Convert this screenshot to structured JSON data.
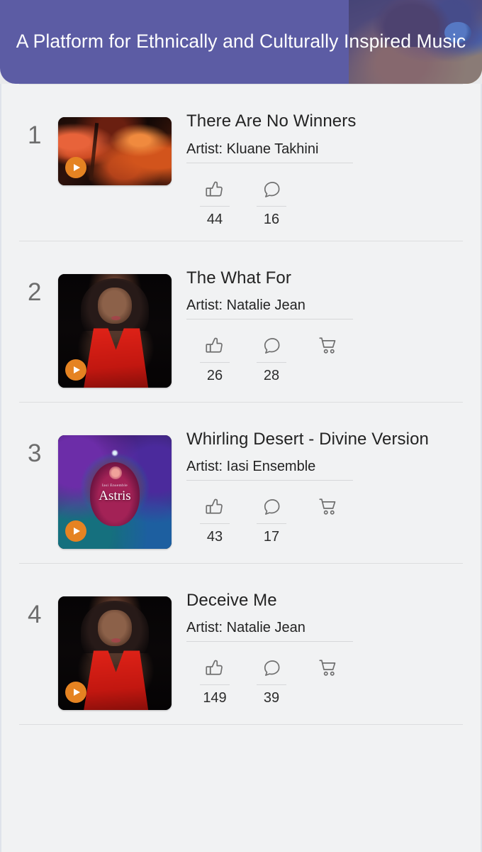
{
  "header": {
    "title": "A Platform for Ethnically and Culturally Inspired Music",
    "background_color": "#5c5ca4",
    "photo_alt": "woman-with-headphones-photo"
  },
  "accent_colors": {
    "play_button": "#e58322",
    "header_purple": "#5c5ca4",
    "page_background": "#f1f2f3",
    "rank_text": "#6d6d6d"
  },
  "icons": {
    "play": "play-icon",
    "like": "thumbs-up-icon",
    "comment": "comment-bubble-icon",
    "cart": "shopping-cart-icon"
  },
  "artist_prefix": "Artist: ",
  "tracks": [
    {
      "rank": "1",
      "title": "There Are No Winners",
      "artist_line": "Artist: Kluane Takhini",
      "artwork": "stage-concert-orange",
      "thumb_shape": "landscape",
      "likes": "44",
      "comments": "16",
      "has_cart": false
    },
    {
      "rank": "2",
      "title": "The What For",
      "artist_line": "Artist: Natalie Jean",
      "artwork": "portrait-red-dress",
      "thumb_shape": "square",
      "likes": "26",
      "comments": "28",
      "has_cart": true
    },
    {
      "rank": "3",
      "title": "Whirling Desert - Divine Version",
      "artist_line": "Artist: Iasi Ensemble",
      "artwork": "cosmic-astris-cover",
      "artwork_text_small": "Iasi Ensemble",
      "artwork_text_main": "Astris",
      "thumb_shape": "square",
      "likes": "43",
      "comments": "17",
      "has_cart": true
    },
    {
      "rank": "4",
      "title": "Deceive Me",
      "artist_line": "Artist: Natalie Jean",
      "artwork": "portrait-red-dress",
      "thumb_shape": "square",
      "likes": "149",
      "comments": "39",
      "has_cart": true
    }
  ]
}
